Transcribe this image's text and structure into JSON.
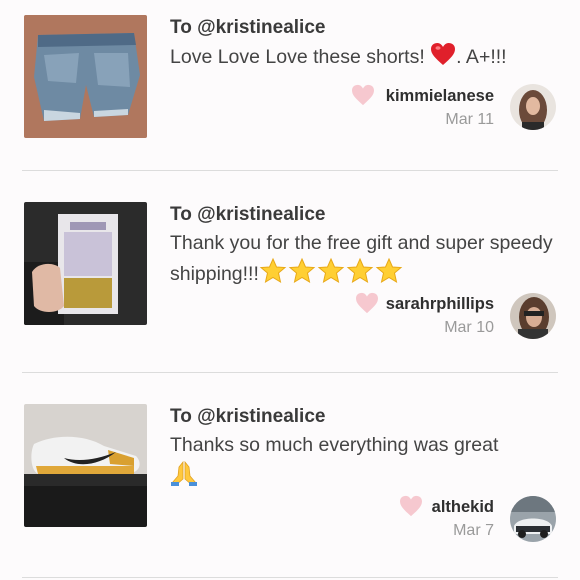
{
  "reviews": [
    {
      "recipient": "To @kristinealice",
      "message_before": "Love Love Love these shorts! ",
      "message_after": ". A+!!!",
      "emoji": "red-heart",
      "username": "kimmielanese",
      "date": "Mar 11",
      "photo": "denim-shorts"
    },
    {
      "recipient": "To @kristinealice",
      "message": "Thank you for the free gift and super speedy shipping!!!",
      "emoji": "five-stars",
      "username": "sarahrphillips",
      "date": "Mar 10",
      "photo": "tarte-gift-set"
    },
    {
      "recipient": "To @kristinealice",
      "message": "Thanks so much everything was great",
      "emoji": "folded-hands",
      "username": "althekid",
      "date": "Mar 7",
      "photo": "nike-sneakers"
    }
  ],
  "colors": {
    "heart": "#f6c8cf",
    "divider": "#dcdcdc",
    "date": "#9a9a9a",
    "background": "#fdfbfc"
  }
}
